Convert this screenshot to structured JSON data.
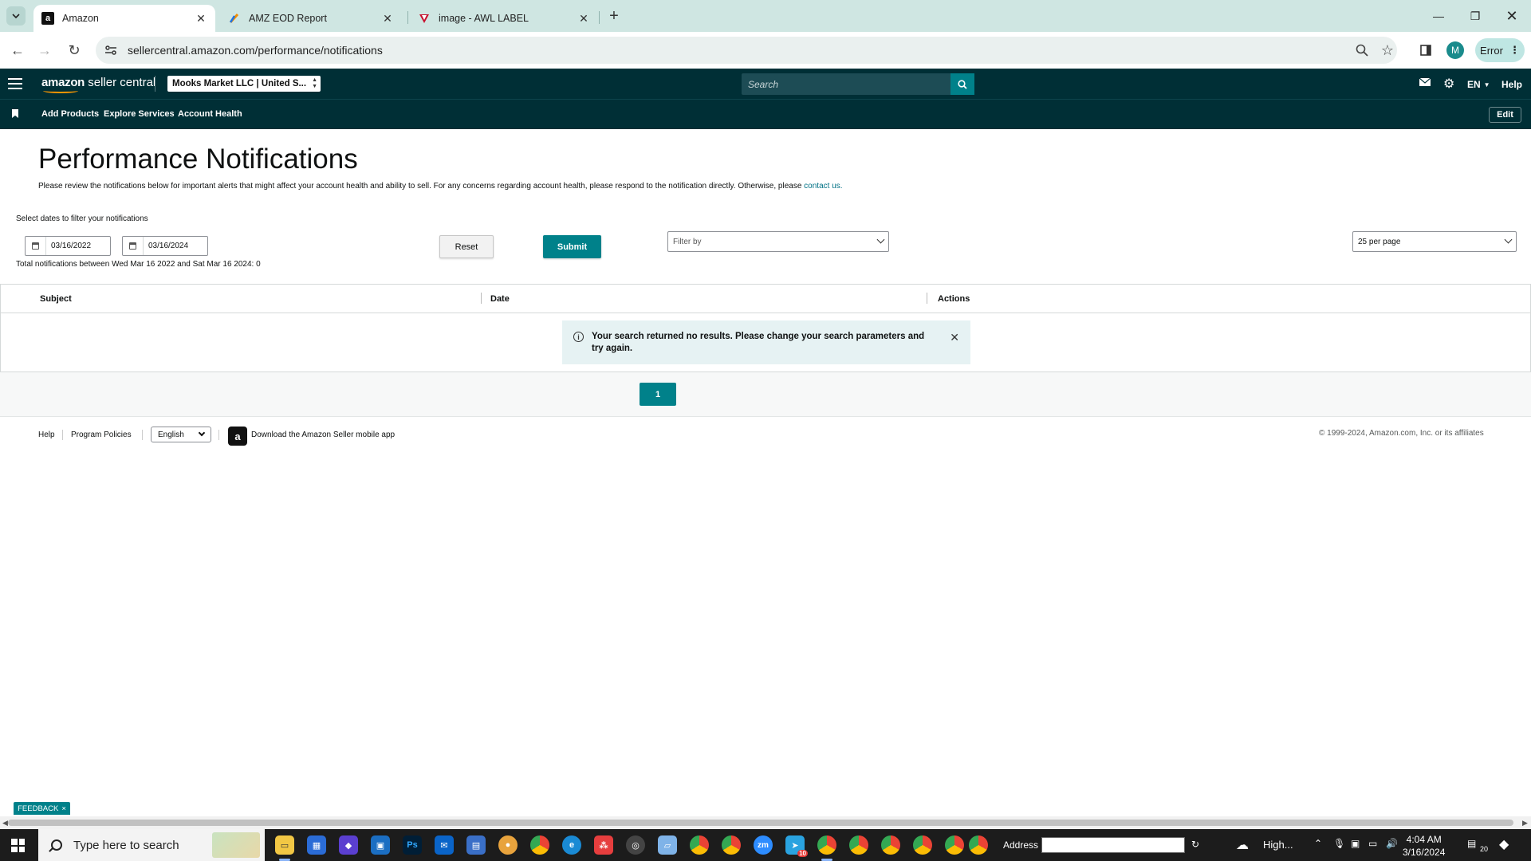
{
  "browser": {
    "tabs": [
      {
        "title": "Amazon",
        "favicon": "a",
        "active": true
      },
      {
        "title": "AMZ EOD Report",
        "favicon": "paint-icon",
        "active": false
      },
      {
        "title": "image - AWL LABEL",
        "favicon": "awl-icon",
        "active": false
      }
    ],
    "url": "sellercentral.amazon.com/performance/notifications",
    "profile_initial": "M",
    "error_label": "Error"
  },
  "header": {
    "logo_brand": "amazon",
    "logo_product": "seller central",
    "account": "Mooks Market LLC | United S...",
    "search_placeholder": "Search",
    "language": "EN",
    "help": "Help"
  },
  "subnav": {
    "links": [
      "Add Products",
      "Explore Services",
      "Account Health"
    ],
    "edit_label": "Edit"
  },
  "page": {
    "title": "Performance Notifications",
    "description": "Please review the notifications below for important alerts that might affect your account health and ability to sell. For any concerns regarding account health, please respond to the notification directly. Otherwise, please",
    "contact_link": "contact us.",
    "filter_label": "Select dates to filter your notifications",
    "start_date": "03/16/2022",
    "end_date": "03/16/2024",
    "reset_label": "Reset",
    "submit_label": "Submit",
    "filter_by": "Filter by",
    "per_page": "25 per page",
    "total_line": "Total notifications between Wed Mar 16 2022 and Sat Mar 16 2024: 0"
  },
  "table": {
    "columns": [
      "Subject",
      "Date",
      "Actions"
    ],
    "no_results": "Your search returned no results. Please change your search parameters and try again."
  },
  "pagination": {
    "current_page": "1"
  },
  "footer": {
    "help": "Help",
    "program_policies": "Program Policies",
    "language": "English",
    "app_text": "Download the Amazon Seller mobile app",
    "copyright": "© 1999-2024, Amazon.com, Inc. or its affiliates"
  },
  "feedback": {
    "label": "FEEDBACK",
    "close": "×"
  },
  "taskbar": {
    "search_placeholder": "Type here to search",
    "address_label": "Address",
    "weather": "High...",
    "time": "4:04 AM",
    "date": "3/16/2024",
    "notifications": "20",
    "badge_count": "10"
  },
  "colors": {
    "header_bg": "#002f36",
    "accent_teal": "#00818a",
    "tabstrip_bg": "#cfe6e2",
    "alert_bg": "#e6f2f3"
  }
}
